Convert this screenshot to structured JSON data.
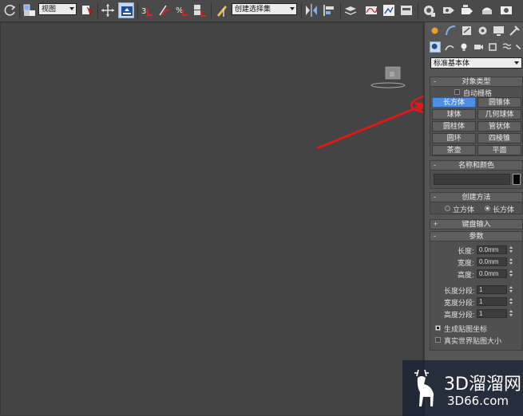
{
  "toolbar": {
    "view_dropdown": "视图",
    "selection_set_dropdown": "创建选择集",
    "icons": [
      "undo-icon",
      "select-filter-icon",
      "select-region-icon",
      "move-icon",
      "scale-icon",
      "snap-3-icon",
      "angle-snap-icon",
      "percent-snap-icon",
      "spinner-snap-icon",
      "edit-named-sel-icon",
      "mirror-icon",
      "align-icon",
      "layer-icon",
      "curve-editor-icon",
      "schematic-icon",
      "material-editor-icon",
      "render-setup-icon",
      "render-frame-icon",
      "render-icon"
    ]
  },
  "panel": {
    "tabs": [
      "create-tab",
      "modify-tab",
      "hierarchy-tab",
      "motion-tab",
      "display-tab",
      "utilities-tab"
    ],
    "category": "标准基本体",
    "object_type": {
      "title": "对象类型",
      "autogrid": "自动栅格",
      "buttons": [
        "长方体",
        "圆锥体",
        "球体",
        "几何球体",
        "圆柱体",
        "管状体",
        "圆环",
        "四棱锥",
        "茶壶",
        "平面"
      ]
    },
    "name_color": {
      "title": "名称和颜色",
      "color": "#000000"
    },
    "creation_method": {
      "title": "创建方法",
      "opt1": "立方体",
      "opt2": "长方体"
    },
    "keyboard_entry": {
      "title": "键盘输入"
    },
    "parameters": {
      "title": "参数",
      "length_label": "长度:",
      "length_val": "0.0mm",
      "width_label": "宽度:",
      "width_val": "0.0mm",
      "height_label": "高度:",
      "height_val": "0.0mm",
      "lseg_label": "长度分段:",
      "lseg_val": "1",
      "wseg_label": "宽度分段:",
      "wseg_val": "1",
      "hseg_label": "高度分段:",
      "hseg_val": "1",
      "gen_map": "生成贴图坐标",
      "real_world": "真实世界贴图大小"
    }
  },
  "watermark": {
    "title": "3D溜溜网",
    "url": "3D66.com"
  },
  "colors": {
    "active_button": "#4e8ee6",
    "annotation": "#e01818"
  }
}
